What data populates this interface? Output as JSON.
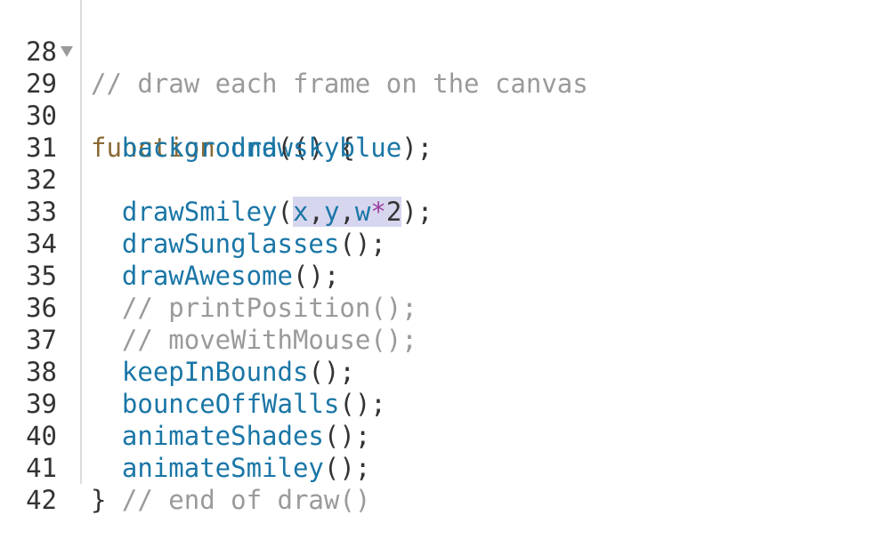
{
  "lines": [
    {
      "num": "28",
      "tokens": [
        "// draw each frame on the canvas"
      ]
    },
    {
      "num": "29",
      "tokens": [
        "function",
        " ",
        "draw",
        "() {"
      ]
    },
    {
      "num": "30",
      "tokens": [
        "  ",
        "background",
        "(",
        "skyblue",
        ");"
      ]
    },
    {
      "num": "31",
      "tokens": []
    },
    {
      "num": "32",
      "tokens": [
        "  ",
        "drawSmiley",
        "(",
        "x",
        ",",
        "y",
        ",",
        "w",
        "*",
        "2",
        ");"
      ]
    },
    {
      "num": "33",
      "tokens": [
        "  ",
        "drawSunglasses",
        "();"
      ]
    },
    {
      "num": "34",
      "tokens": [
        "  ",
        "drawAwesome",
        "();"
      ]
    },
    {
      "num": "35",
      "tokens": [
        "  ",
        "// printPosition();"
      ]
    },
    {
      "num": "36",
      "tokens": [
        "  ",
        "// moveWithMouse();"
      ]
    },
    {
      "num": "37",
      "tokens": [
        "  ",
        "keepInBounds",
        "();"
      ]
    },
    {
      "num": "38",
      "tokens": [
        "  ",
        "bounceOffWalls",
        "();"
      ]
    },
    {
      "num": "39",
      "tokens": [
        "  ",
        "animateShades",
        "();"
      ]
    },
    {
      "num": "40",
      "tokens": [
        "  ",
        "animateSmiley",
        "();"
      ]
    },
    {
      "num": "41",
      "tokens": [
        "} ",
        "// end of draw()"
      ]
    },
    {
      "num": "42",
      "tokens": []
    }
  ],
  "colors": {
    "comment": "#9a9a9a",
    "keyword": "#8a6a35",
    "function": "#1a76a6",
    "operator": "#9a3fa0",
    "selection": "#d7d6ef"
  }
}
